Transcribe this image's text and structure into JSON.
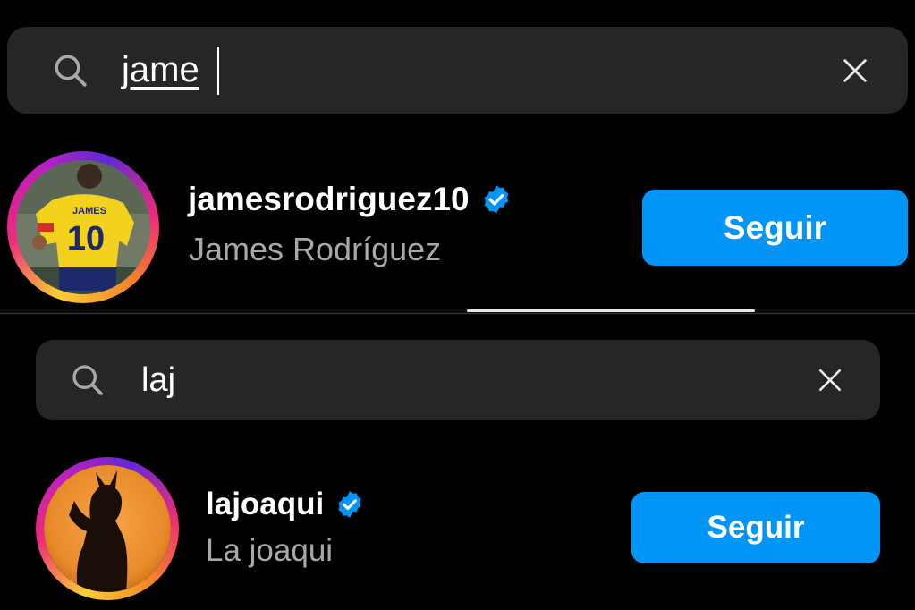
{
  "top": {
    "search": {
      "query": "jame"
    },
    "result": {
      "username": "jamesrodriguez10",
      "full_name": "James Rodríguez",
      "verified": true,
      "follow_label": "Seguir",
      "jersey_name": "JAMES",
      "jersey_number": "10"
    }
  },
  "bottom": {
    "search": {
      "query": "laj"
    },
    "result": {
      "username": "lajoaqui",
      "full_name": "La joaqui",
      "verified": true,
      "follow_label": "Seguir"
    }
  },
  "colors": {
    "background": "#000000",
    "search_field": "#262626",
    "follow_button": "#0095f6",
    "verified_badge": "#0095f6",
    "secondary_text": "#a8a8a8"
  },
  "icons": {
    "search": "search-icon",
    "clear": "close-icon",
    "verified": "verified-badge-icon"
  }
}
